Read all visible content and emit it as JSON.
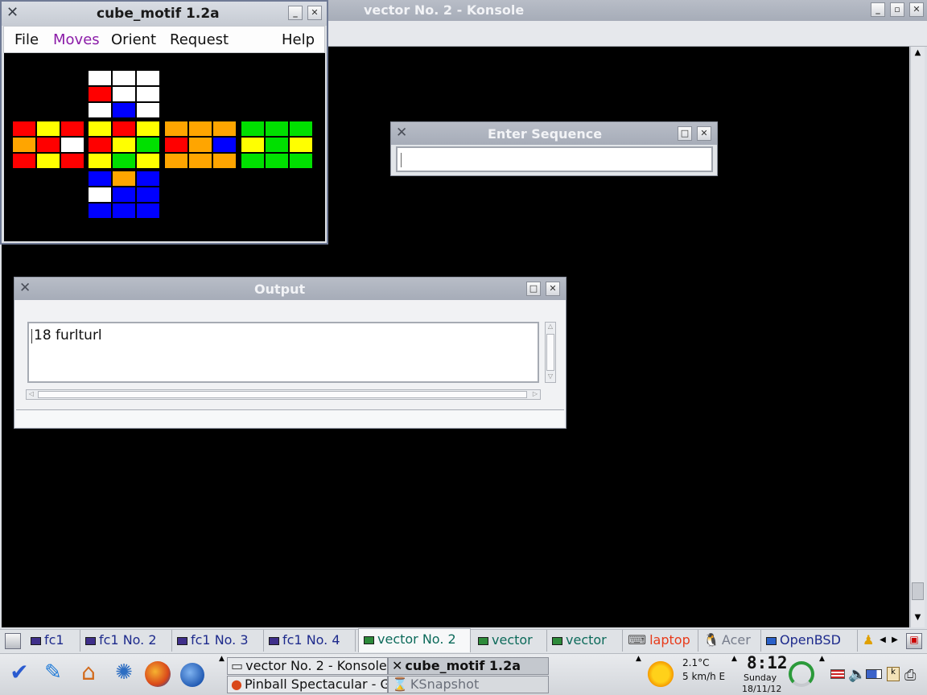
{
  "konsole": {
    "title": "vector No. 2 - Konsole"
  },
  "cube": {
    "title": "cube_motif 1.2a",
    "menu": [
      {
        "label": "File"
      },
      {
        "label": "Moves"
      },
      {
        "label": "Orient"
      },
      {
        "label": "Request"
      },
      {
        "label": "Help"
      }
    ],
    "colors": {
      "W": "#ffffff",
      "R": "#ff0000",
      "B": "#0000ff",
      "Y": "#ffff00",
      "O": "#ffa500",
      "G": "#00e000"
    },
    "faces": {
      "top": [
        "WWW",
        "RWW",
        "WBW"
      ],
      "left": [
        "RYR",
        "ORW",
        "RYR"
      ],
      "front": [
        "YRY",
        "RYG",
        "YGY"
      ],
      "right": [
        "OOO",
        "ROB",
        "OOO"
      ],
      "back": [
        "GGG",
        "YGY",
        "GGG"
      ],
      "bottom": [
        "BOB",
        "WBB",
        "BBB"
      ]
    }
  },
  "enter_seq": {
    "title": "Enter Sequence",
    "value": ""
  },
  "output": {
    "title": "Output",
    "text": "18 furlturl",
    "status": ""
  },
  "taskbar": {
    "tabs": [
      {
        "label": "fc1",
        "icon": "konsole-icon"
      },
      {
        "label": "fc1 No. 2",
        "icon": "konsole-icon"
      },
      {
        "label": "fc1 No. 3",
        "icon": "konsole-icon"
      },
      {
        "label": "fc1 No. 4",
        "icon": "konsole-icon"
      },
      {
        "label": "vector No. 2",
        "icon": "terminal-icon"
      },
      {
        "label": "vector",
        "icon": "terminal-icon"
      },
      {
        "label": "vector",
        "icon": "terminal-icon"
      },
      {
        "label": "laptop",
        "icon": "laptop-icon"
      },
      {
        "label": "Acer",
        "icon": "tux-icon"
      },
      {
        "label": "OpenBSD",
        "icon": "monitor-icon"
      }
    ],
    "windows": [
      {
        "label": "vector No. 2 - Konsole"
      },
      {
        "label": "cube_motif 1.2a"
      },
      {
        "label": "Pinball Spectacular - Game"
      },
      {
        "label": "KSnapshot"
      }
    ],
    "weather": {
      "temp": "2.1°C",
      "wind": "5 km/h E"
    },
    "clock": {
      "time": "8:12",
      "day": "Sunday",
      "date": "18/11/12"
    }
  }
}
